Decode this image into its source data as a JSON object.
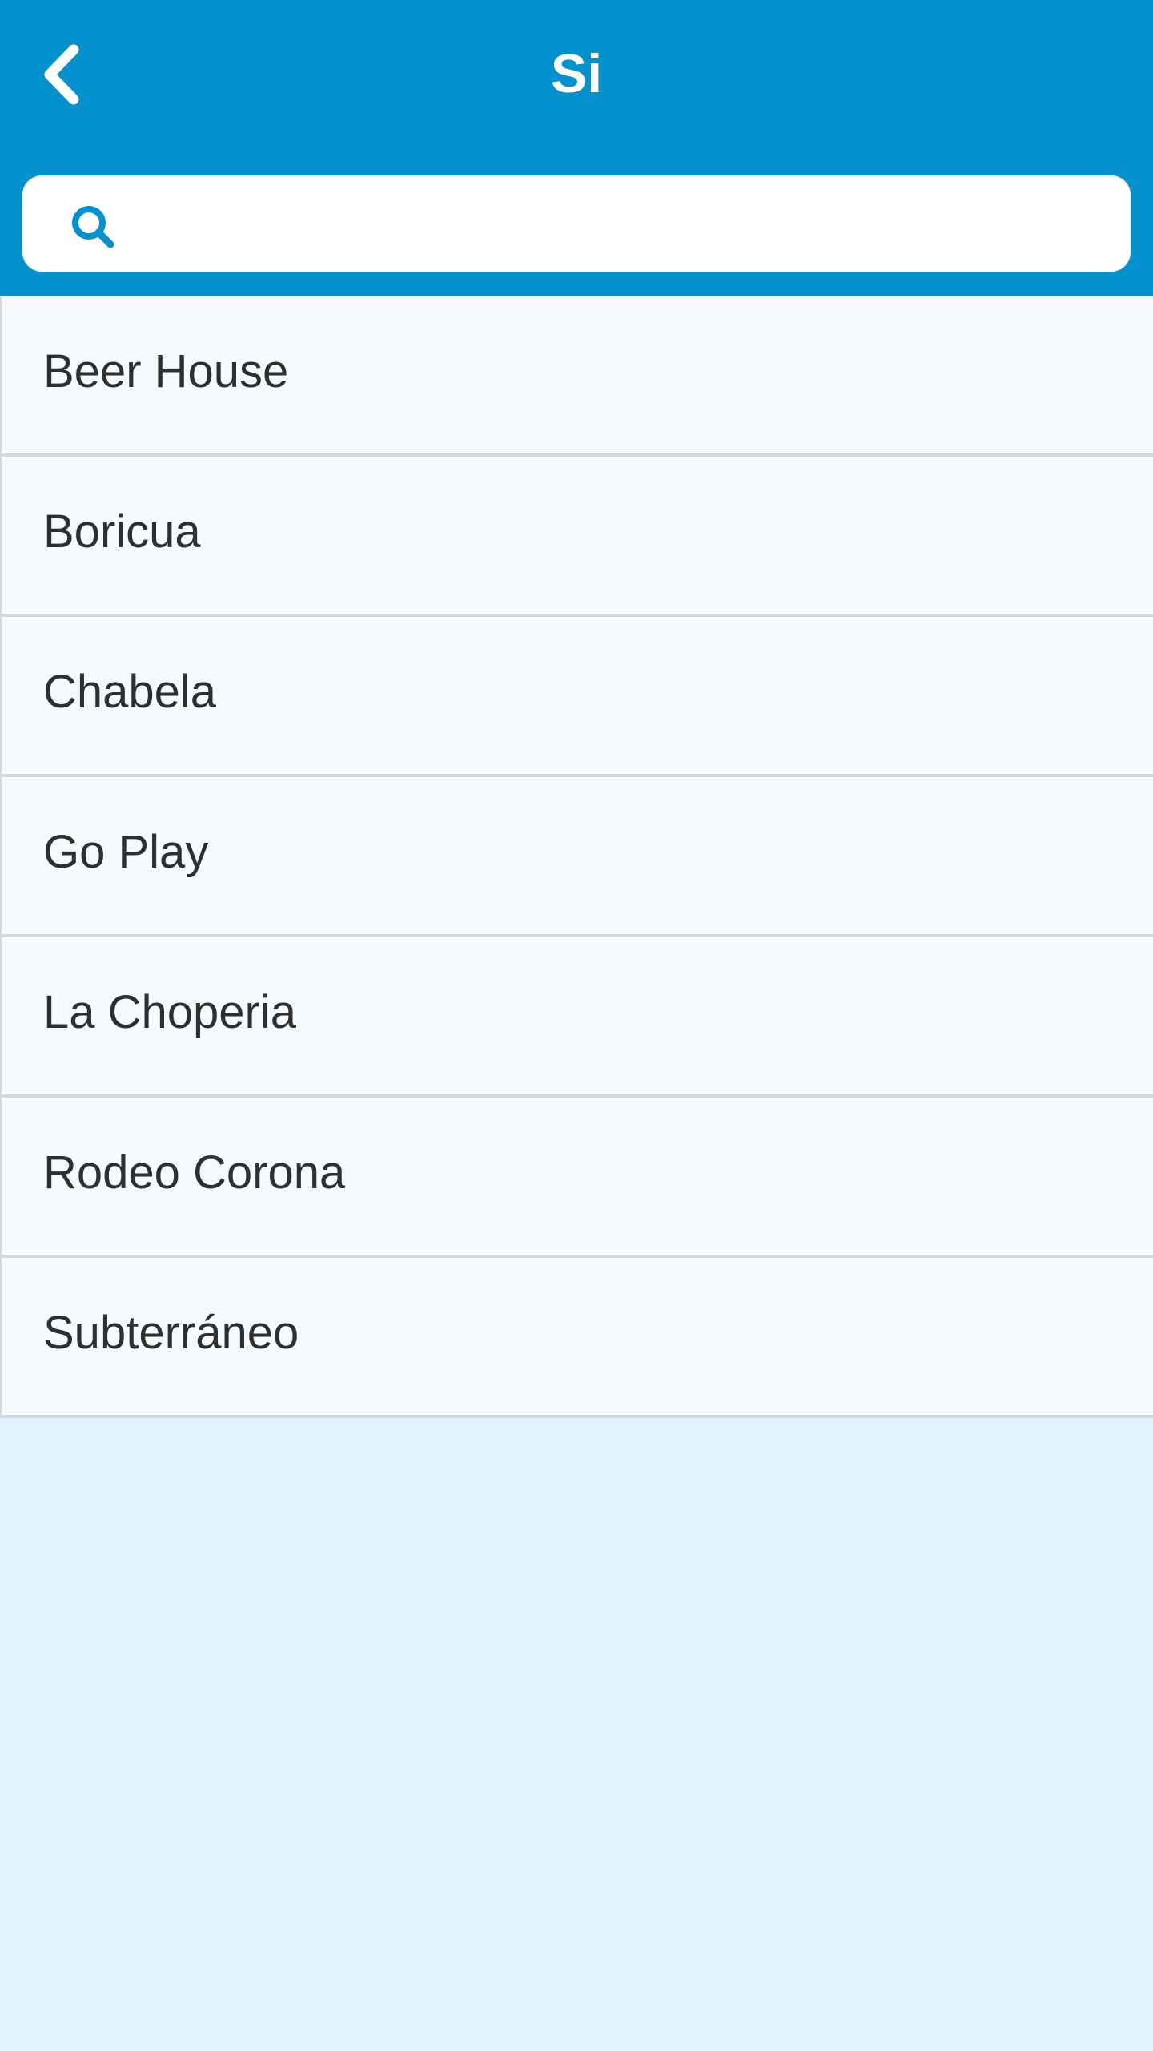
{
  "header": {
    "title": "Si",
    "background_color": "#0392ce",
    "back_icon": "chevron-left-icon"
  },
  "search": {
    "placeholder": "",
    "value": "",
    "icon": "search-icon",
    "icon_color": "#0392ce"
  },
  "list": {
    "items": [
      {
        "label": "Beer House"
      },
      {
        "label": "Boricua"
      },
      {
        "label": "Chabela"
      },
      {
        "label": "Go Play"
      },
      {
        "label": "La Choperia"
      },
      {
        "label": "Rodeo Corona"
      },
      {
        "label": "Subterráneo"
      }
    ]
  },
  "colors": {
    "page_background": "#e1f4fb",
    "row_background": "#f4fafe",
    "divider": "#d2d8dc",
    "text": "#2f2f2f"
  }
}
